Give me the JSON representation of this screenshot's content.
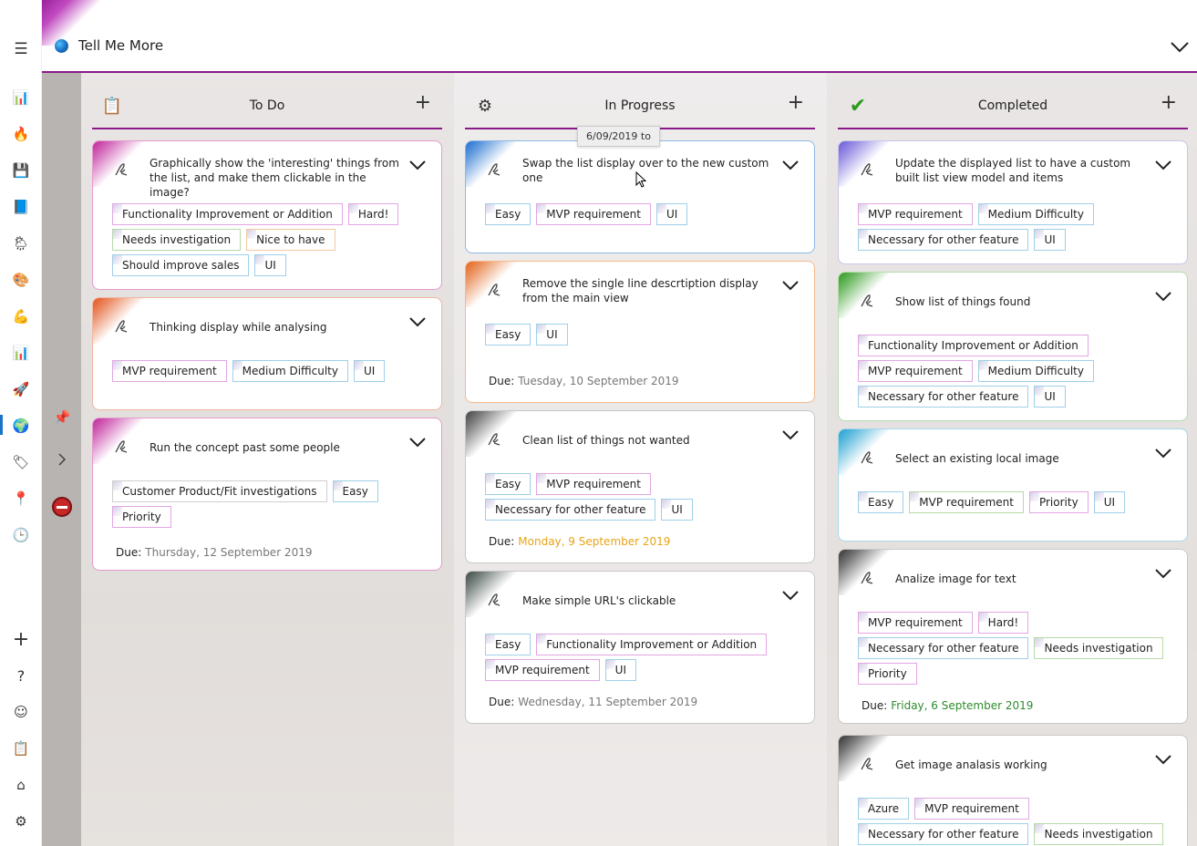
{
  "app": {
    "title": "Tell Me More",
    "accent": "#8a1a8a"
  },
  "rail": {
    "top_icons": [
      "hamburger-icon",
      "bar-chart-icon",
      "flame-icon",
      "save-icon",
      "book-icon",
      "weather-icon",
      "palette-icon",
      "muscle-icon",
      "bar-chart-icon",
      "rocket-icon",
      "globe-icon",
      "tag-icon",
      "pin-icon",
      "clock-icon"
    ],
    "bottom_icons": [
      "add-icon",
      "help-icon",
      "smiley-icon",
      "clipboard-icon",
      "home-icon",
      "settings-icon"
    ]
  },
  "board": {
    "columns": [
      {
        "title": "To Do",
        "icon": "clipboard-icon",
        "cards": [
          {
            "title": "Graphically show the 'interesting' things from the list, and make them clickable in the image?",
            "flourish": "#c0269c",
            "border": "#e69acb",
            "tags": [
              {
                "label": "Functionality Improvement or Addition",
                "tone": "pink"
              },
              {
                "label": "Hard!",
                "tone": "pink"
              },
              {
                "label": "Needs investigation",
                "tone": "green"
              },
              {
                "label": "Nice to have",
                "tone": "orange"
              },
              {
                "label": "Should improve sales",
                "tone": "blue"
              },
              {
                "label": "UI",
                "tone": "blue"
              }
            ]
          },
          {
            "title": "Thinking display while analysing",
            "flourish": "#e2541c",
            "border": "#f0b7a0",
            "tags": [
              {
                "label": "MVP requirement",
                "tone": "pink"
              },
              {
                "label": "Medium Difficulty",
                "tone": "blue"
              },
              {
                "label": "UI",
                "tone": "blue"
              }
            ]
          },
          {
            "title": "Run the concept past some people",
            "flourish": "#c0269c",
            "border": "#e69acb",
            "tags": [
              {
                "label": "Customer Product/Fit investigations",
                "tone": "grey"
              },
              {
                "label": "Easy",
                "tone": "blue"
              },
              {
                "label": "Priority",
                "tone": "pink"
              }
            ],
            "due_label": "Due:",
            "due_date": "Thursday, 12 September 2019",
            "due_tone": "grey"
          }
        ]
      },
      {
        "title": "In Progress",
        "icon": "gear-icon",
        "tooltip": "6/09/2019 to",
        "cards": [
          {
            "title": "Swap the list display over to the new custom one",
            "flourish": "#1f6fd0",
            "border": "#8fb8e8",
            "tags": [
              {
                "label": "Easy",
                "tone": "blue"
              },
              {
                "label": "MVP requirement",
                "tone": "pink"
              },
              {
                "label": "UI",
                "tone": "blue"
              }
            ]
          },
          {
            "title": "Remove the single line descrtiption display from the main view",
            "flourish": "#e2641c",
            "border": "#f4b98a",
            "tags": [
              {
                "label": "Easy",
                "tone": "blue"
              },
              {
                "label": "UI",
                "tone": "blue"
              }
            ],
            "due_label": "Due:",
            "due_date": "Tuesday, 10 September 2019",
            "due_tone": "grey"
          },
          {
            "title": "Clean list of things not wanted",
            "flourish": "#444444",
            "border": "#c8c8c8",
            "tags": [
              {
                "label": "Easy",
                "tone": "blue"
              },
              {
                "label": "MVP requirement",
                "tone": "pink"
              },
              {
                "label": "Necessary for other feature",
                "tone": "blue"
              },
              {
                "label": "UI",
                "tone": "blue"
              }
            ],
            "due_label": "Due:",
            "due_date": "Monday, 9 September 2019",
            "due_tone": "orange"
          },
          {
            "title": "Make simple URL's clickable",
            "flourish": "#3b4a44",
            "border": "#c8c8c8",
            "tags": [
              {
                "label": "Easy",
                "tone": "blue"
              },
              {
                "label": "Functionality Improvement or Addition",
                "tone": "pink"
              },
              {
                "label": "MVP requirement",
                "tone": "pink"
              },
              {
                "label": "UI",
                "tone": "blue"
              }
            ],
            "due_label": "Due:",
            "due_date": "Wednesday, 11 September 2019",
            "due_tone": "grey"
          }
        ]
      },
      {
        "title": "Completed",
        "icon": "checkmark-icon",
        "cards": [
          {
            "title": "Update the displayed list to have a custom built list view model and items",
            "flourish": "#6a5ad8",
            "border": "#c8c8e8",
            "tags": [
              {
                "label": "MVP requirement",
                "tone": "pink"
              },
              {
                "label": "Medium Difficulty",
                "tone": "blue"
              },
              {
                "label": "Necessary for other feature",
                "tone": "blue"
              },
              {
                "label": "UI",
                "tone": "blue"
              }
            ]
          },
          {
            "title": "Show list of things found",
            "flourish": "#2e9a1e",
            "border": "#b8ddb0",
            "tags": [
              {
                "label": "Functionality Improvement or Addition",
                "tone": "pink"
              },
              {
                "label": "MVP requirement",
                "tone": "pink"
              },
              {
                "label": "Medium Difficulty",
                "tone": "blue"
              },
              {
                "label": "Necessary for other feature",
                "tone": "blue"
              },
              {
                "label": "UI",
                "tone": "blue"
              }
            ]
          },
          {
            "title": "Select an existing local image",
            "flourish": "#1fa0d0",
            "border": "#a8d8ea",
            "tags": [
              {
                "label": "Easy",
                "tone": "blue"
              },
              {
                "label": "MVP requirement",
                "tone": "green"
              },
              {
                "label": "Priority",
                "tone": "pink"
              },
              {
                "label": "UI",
                "tone": "blue"
              }
            ]
          },
          {
            "title": "Analize image for text",
            "flourish": "#333333",
            "border": "#c8c8c8",
            "tags": [
              {
                "label": "MVP requirement",
                "tone": "pink"
              },
              {
                "label": "Hard!",
                "tone": "pink"
              },
              {
                "label": "Necessary for other feature",
                "tone": "blue"
              },
              {
                "label": "Needs investigation",
                "tone": "green"
              },
              {
                "label": "Priority",
                "tone": "pink"
              }
            ],
            "due_label": "Due:",
            "due_date": "Friday, 6 September 2019",
            "due_tone": "green"
          },
          {
            "title": "Get image analasis working",
            "flourish": "#333333",
            "border": "#c8c8c8",
            "tags": [
              {
                "label": "Azure",
                "tone": "blue"
              },
              {
                "label": "MVP requirement",
                "tone": "pink"
              },
              {
                "label": "Necessary for other feature",
                "tone": "blue"
              },
              {
                "label": "Needs investigation",
                "tone": "green"
              }
            ]
          }
        ]
      }
    ]
  }
}
